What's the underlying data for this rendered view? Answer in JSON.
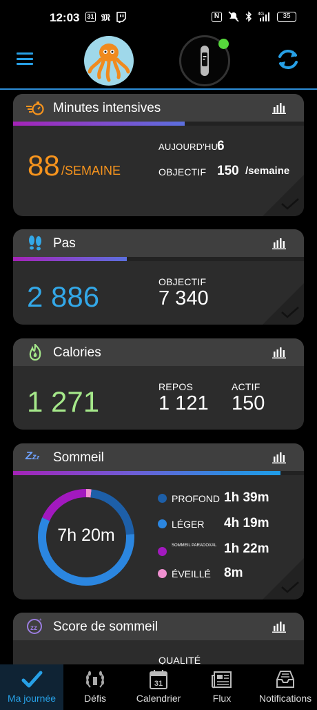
{
  "statusbar": {
    "time": "12:03",
    "calendar_day": "31",
    "battery": "35",
    "network": "4G"
  },
  "intensity": {
    "title": "Minutes intensives",
    "value": "88",
    "unit": "/SEMAINE",
    "today_label": "AUJOURD'HUI",
    "today_value": "6",
    "goal_label": "OBJECTIF",
    "goal_value": "150",
    "goal_unit": "/semaine",
    "progress": 0.59
  },
  "steps": {
    "title": "Pas",
    "value": "2 886",
    "goal_label": "OBJECTIF",
    "goal_value": "7 340",
    "progress": 0.39
  },
  "calories": {
    "title": "Calories",
    "value": "1 271",
    "rest_label": "REPOS",
    "rest_value": "1 121",
    "active_label": "ACTIF",
    "active_value": "150"
  },
  "sleep": {
    "title": "Sommeil",
    "total": "7h 20m",
    "progress": 0.92,
    "items": [
      {
        "label": "PROFOND",
        "value": "1h 39m",
        "color": "#1d5fa8"
      },
      {
        "label": "LÉGER",
        "value": "4h 19m",
        "color": "#2b86e0"
      },
      {
        "label": "SOMMEIL PARADOXAL",
        "value": "1h 22m",
        "color": "#a219bf"
      },
      {
        "label": "ÉVEILLÉ",
        "value": "8m",
        "color": "#f090d0"
      }
    ]
  },
  "sleep_score": {
    "title": "Score de sommeil",
    "quality_label": "QUALITÉ"
  },
  "nav": {
    "my_day": "Ma journée",
    "challenges": "Défis",
    "calendar": "Calendrier",
    "calendar_day": "31",
    "feed": "Flux",
    "notifications": "Notifications"
  },
  "colors": {
    "accent": "#27a0e6",
    "intensity": "#f7941d",
    "steps": "#33a8e8",
    "calories": "#a5e88a",
    "card": "#2c2c2c",
    "card_header": "#3f3f3f"
  }
}
